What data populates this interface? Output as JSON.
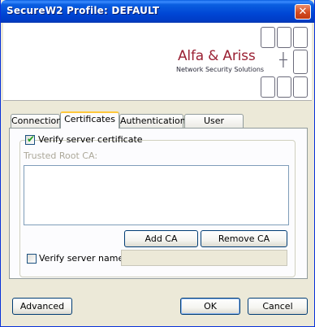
{
  "window": {
    "title": "SecureW2 Profile: DEFAULT",
    "close_label": "✕"
  },
  "banner": {
    "brand_name": "Alfa & Ariss",
    "brand_subtitle": "Network Security Solutions"
  },
  "tabs": [
    {
      "label": "Connection"
    },
    {
      "label": "Certificates"
    },
    {
      "label": "Authentication"
    },
    {
      "label": "User account"
    }
  ],
  "certificates": {
    "verify_server_certificate_label": "Verify server certificate",
    "verify_server_certificate_checked": true,
    "trusted_root_ca_label": "Trusted Root CA:",
    "trusted_root_ca_items": [],
    "add_ca_label": "Add CA",
    "remove_ca_label": "Remove CA",
    "verify_server_name_label": "Verify server name:",
    "verify_server_name_checked": false,
    "server_name_value": ""
  },
  "footer": {
    "advanced_label": "Advanced",
    "ok_label": "OK",
    "cancel_label": "Cancel"
  }
}
